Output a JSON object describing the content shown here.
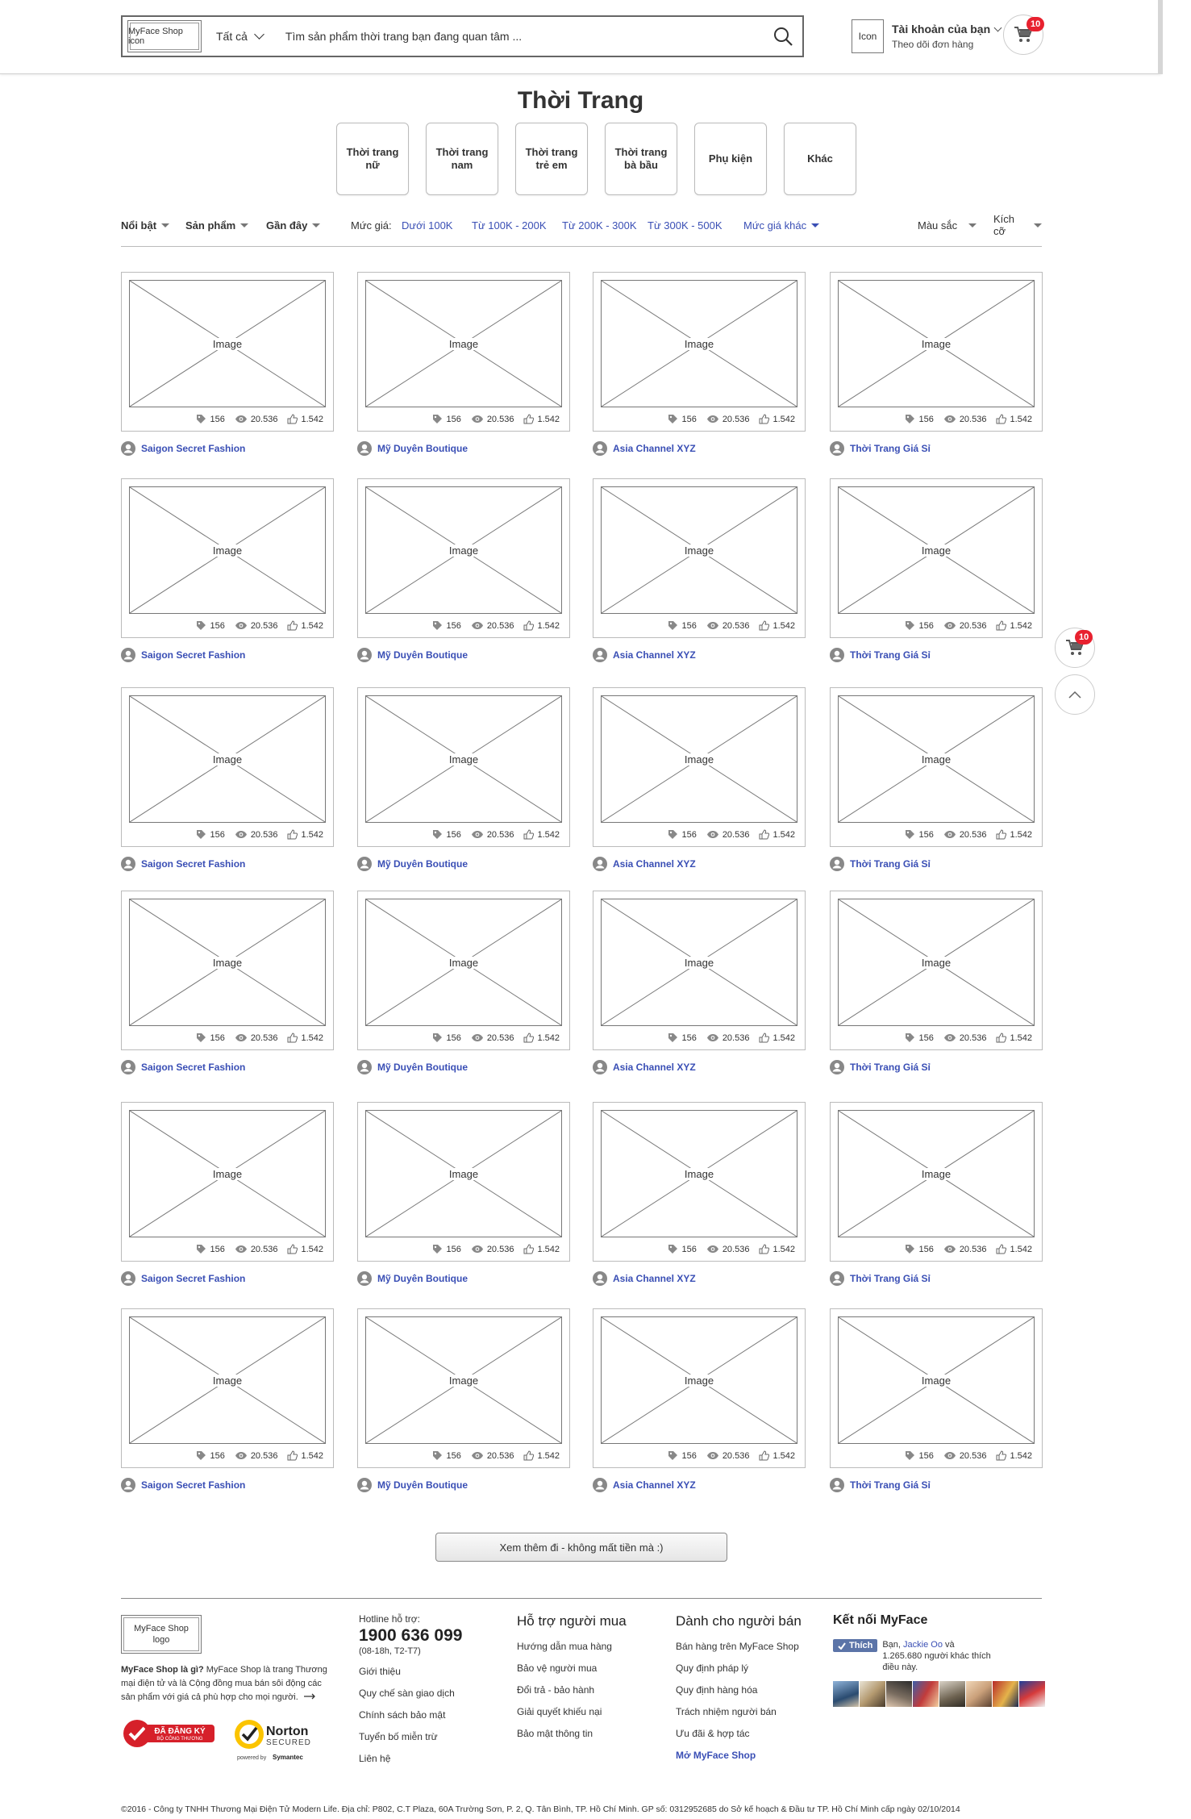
{
  "header": {
    "logo_label": "MyFace Shop icon",
    "scope_label": "Tất cả",
    "search_placeholder": "Tìm sản phẩm thời trang bạn đang quan tâm ...",
    "account_icon_label": "Icon",
    "account_title": "Tài khoản của bạn",
    "account_sub": "Theo dõi đơn hàng",
    "cart_count": "10"
  },
  "page_title": "Thời Trang",
  "categories": [
    {
      "label": "Thời trang nữ"
    },
    {
      "label": "Thời trang nam"
    },
    {
      "label": "Thời trang trẻ em"
    },
    {
      "label": "Thời trang bà bầu"
    },
    {
      "label": "Phụ kiện"
    },
    {
      "label": "Khác"
    }
  ],
  "filters": {
    "sort": [
      "Nổi bật",
      "Sản phẩm",
      "Gần đây"
    ],
    "price_label": "Mức giá:",
    "prices": [
      "Dưới 100K",
      "Từ 100K - 200K",
      "Từ 200K - 300K",
      "Từ 300K - 500K"
    ],
    "price_other": "Mức giá khác",
    "color": "Màu sắc",
    "size": "Kích cỡ"
  },
  "products": {
    "image_label": "Image",
    "tags": "156",
    "views": "20.536",
    "likes": "1.542",
    "shops": [
      "Saigon Secret Fashion",
      "Mỹ Duyên Boutique",
      "Asia Channel XYZ",
      "Thời Trang Giá Sỉ"
    ]
  },
  "float": {
    "cart_count": "10"
  },
  "load_more": "Xem thêm đi - không mất tiền mà :)",
  "footer": {
    "logo_label": "MyFace Shop logo",
    "about_bold": "MyFace Shop là gì?",
    "about_text": " MyFace Shop là trang Thương mại điện tử và là Cộng đồng mua bán sôi động các sản phẩm với giá cả phù hợp cho mọi người.",
    "cert1_top": "ĐÃ ĐĂNG KÝ",
    "cert1_bottom": "BỘ CÔNG THƯƠNG",
    "cert2_title": "Norton",
    "cert2_sub": "SECURED",
    "cert2_by": "powered by",
    "cert2_brand": "Symantec",
    "hotline_label": "Hotline hỗ trợ:",
    "hotline": "1900 636 099",
    "hotline_hours": "(08-18h, T2-T7)",
    "col1": [
      "Giới thiệu",
      "Quy chế sàn giao dịch",
      "Chính sách bảo mật",
      "Tuyển bố miễn trừ",
      "Liên hệ"
    ],
    "col2_title": "Hỗ trợ người mua",
    "col2": [
      "Hướng dẫn mua hàng",
      "Bảo vệ người mua",
      "Đổi trả - bảo hành",
      "Giải quyết khiếu nại",
      "Bảo mật thông tin"
    ],
    "col3_title": "Dành cho người bán",
    "col3": [
      "Bán hàng trên MyFace Shop",
      "Quy định pháp lý",
      "Quy định hàng hóa",
      "Trách nhiệm người bán",
      "Ưu đãi & hợp tác"
    ],
    "col3_cta": "Mở MyFace Shop",
    "col4_title": "Kết nối MyFace",
    "like_label": "Thích",
    "fb_prefix": "Bạn, ",
    "fb_name": "Jackie Oo",
    "fb_suffix": " và 1.265.680 người khác thích điều này.",
    "copyright": "©2016 - Công ty TNHH Thương Mại Điện Tử Modern Life. Địa chỉ: P802, C.T Plaza, 60A Trường Sơn, P. 2, Q. Tân Bình, TP. Hồ Chí Minh. GP số: 0312952685 do Sở kế hoạch & Đầu tư TP. Hồ Chí Minh cấp ngày 02/10/2014"
  },
  "colors": {
    "link": "#3a4fb5",
    "badge": "#e8212f"
  }
}
